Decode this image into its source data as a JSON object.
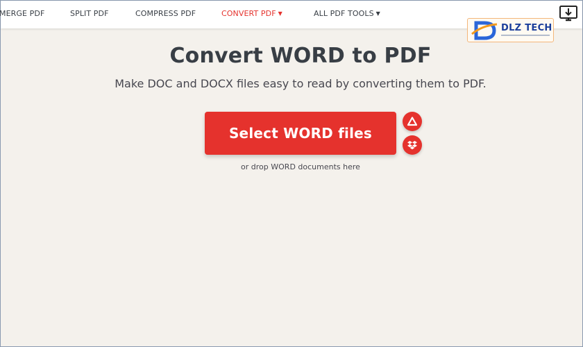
{
  "nav": {
    "items": [
      {
        "label": "MERGE PDF"
      },
      {
        "label": "SPLIT PDF"
      },
      {
        "label": "COMPRESS PDF"
      },
      {
        "label": "CONVERT PDF",
        "active": true,
        "dropdown": true
      },
      {
        "label": "ALL PDF TOOLS",
        "dropdown": true
      }
    ]
  },
  "logo": {
    "text": "DLZ TECH"
  },
  "hero": {
    "title": "Convert WORD to PDF",
    "subtitle": "Make DOC and DOCX files easy to read by converting them to PDF."
  },
  "upload": {
    "button_label": "Select WORD files",
    "drop_hint": "or drop WORD documents here"
  },
  "icons": {
    "download": "download-desktop-icon",
    "google_drive": "google-drive-icon",
    "dropbox": "dropbox-icon",
    "caret": "caret-down-icon"
  },
  "colors": {
    "accent": "#e5322d",
    "background": "#f4f1ec",
    "nav_text": "#383e45",
    "logo_blue": "#1b3e9b"
  }
}
